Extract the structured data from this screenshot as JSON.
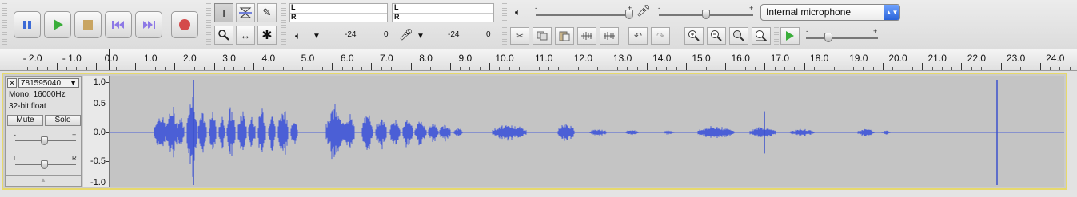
{
  "transport": {
    "buttons": [
      "pause",
      "play",
      "stop",
      "skip-start",
      "skip-end",
      "record"
    ]
  },
  "meters": {
    "L": "L",
    "R": "R",
    "ticks_play": [
      "-24",
      "0"
    ],
    "ticks_rec": [
      "-24",
      "0"
    ]
  },
  "mixer": {
    "minus": "-",
    "plus": "+",
    "device": "Internal microphone"
  },
  "ruler": {
    "labels": [
      "- 2.0",
      "- 1.0",
      "0.0",
      "1.0",
      "2.0",
      "3.0",
      "4.0",
      "5.0",
      "6.0",
      "7.0",
      "8.0",
      "9.0",
      "10.0",
      "11.0",
      "12.0",
      "13.0",
      "14.0",
      "15.0",
      "16.0",
      "17.0",
      "18.0",
      "19.0",
      "20.0",
      "21.0",
      "22.0",
      "23.0",
      "24.0"
    ]
  },
  "track": {
    "close": "✕",
    "name": "781595040",
    "dropdown": "▼",
    "info_rate": "Mono, 16000Hz",
    "info_format": "32-bit float",
    "mute": "Mute",
    "solo": "Solo",
    "gain_minus": "-",
    "gain_plus": "+",
    "pan_left": "L",
    "pan_right": "R",
    "collapse": "▲",
    "vscale": [
      "1.0",
      "0.5",
      "0.0",
      "-0.5",
      "-1.0"
    ]
  }
}
